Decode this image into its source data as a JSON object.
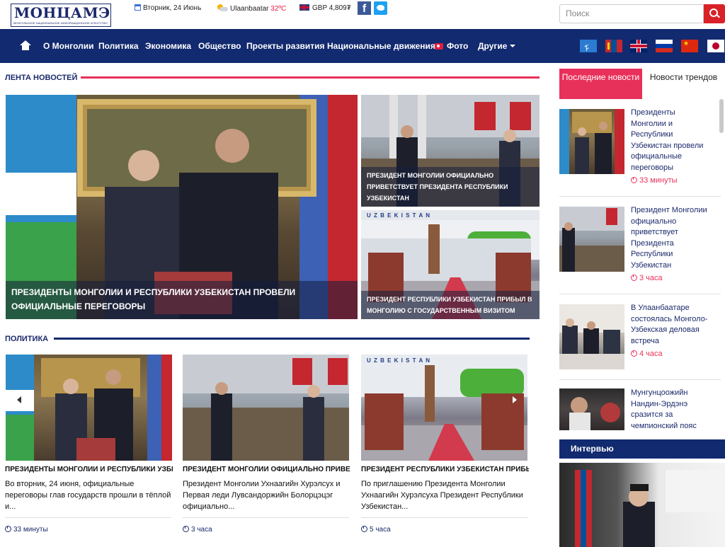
{
  "header": {
    "logo_text": "МОНЦАМЭ",
    "logo_subtitle": "МОНГОЛЬСКОЕ НАЦИОНАЛЬНОЕ ИНФОРМАЦИОННОЕ АГЕНТСТВО",
    "date": "Вторник, 24 Июнь",
    "weather_city": "Ulaanbaatar",
    "weather_temp": "32ºC",
    "currency": "GBP 4,809₮",
    "search_placeholder": "Поиск"
  },
  "nav": {
    "items": [
      "О Монголии",
      "Политика",
      "Экономика",
      "Общество",
      "Проекты развития",
      "Национальные движения",
      "Фото",
      "Другие"
    ]
  },
  "feed": {
    "heading": "ЛЕНТА НОВОСТЕЙ",
    "main_caption": "ПРЕЗИДЕНТЫ МОНГОЛИИ И РЕСПУБЛИКИ УЗБЕКИСТАН ПРОВЕЛИ ОФИЦИАЛЬНЫЕ ПЕРЕГОВОРЫ",
    "top_right_caption": "ПРЕЗИДЕНТ МОНГОЛИИ ОФИЦИАЛЬНО ПРИВЕТСТВУЕТ ПРЕЗИДЕНТА РЕСПУБЛИКИ УЗБЕКИСТАН",
    "bottom_right_caption": "ПРЕЗИДЕНТ РЕСПУБЛИКИ УЗБЕКИСТАН ПРИБЫЛ В МОНГОЛИЮ С ГОСУДАРСТВЕННЫМ ВИЗИТОМ",
    "plane_text": "U Z B E K I S T A N"
  },
  "politics": {
    "heading": "ПОЛИТИКА",
    "cards": [
      {
        "title": "ПРЕЗИДЕНТЫ МОНГОЛИИ И РЕСПУБЛИКИ УЗБЕКИСТАН ПРОВЕЛИ ОФИЦИАЛЬНЫЕ ПЕРЕГОВОРЫ",
        "desc": "Во вторник, 24 июня, официальные переговоры глав государств прошли в тёплой и...",
        "time": "33 минуты"
      },
      {
        "title": "ПРЕЗИДЕНТ МОНГОЛИИ ОФИЦИАЛЬНО ПРИВЕТСТВУЕТ ПРЕЗИДЕНТА",
        "desc": "Президент Монголии Ухнаагийн Хурэлсух и Первая леди Лувсандоржийн Болорцэцэг официально...",
        "time": "3 часа"
      },
      {
        "title": "ПРЕЗИДЕНТ РЕСПУБЛИКИ УЗБЕКИСТАН ПРИБЫЛ В МОНГОЛИЮ",
        "desc": "По приглашению Президента Монголии Ухнаагийн Хурэлсуха Президент Республики Узбекистан...",
        "time": "5 часа"
      }
    ]
  },
  "sidebar": {
    "tab_latest": "Последние новости",
    "tab_trends": "Новости трендов",
    "items": [
      {
        "title": "Президенты Монголии и Республики Узбекистан провели официальные переговоры",
        "time": "33 минуты"
      },
      {
        "title": "Президент Монголии официально приветствует Президента Республики Узбекистан",
        "time": "3 часа"
      },
      {
        "title": "В Улаанбаатаре состоялась Монголо-Узбекская деловая встреча",
        "time": "4 часа"
      },
      {
        "title": "Мунгунцоожийн Нандин-Эрдэнэ сразится за чемпионский пояс",
        "time": ""
      }
    ],
    "interview_heading": "Интервью"
  },
  "colors": {
    "navy": "#122a6f",
    "accent_pink": "#e8315a",
    "search_red": "#d92128"
  }
}
